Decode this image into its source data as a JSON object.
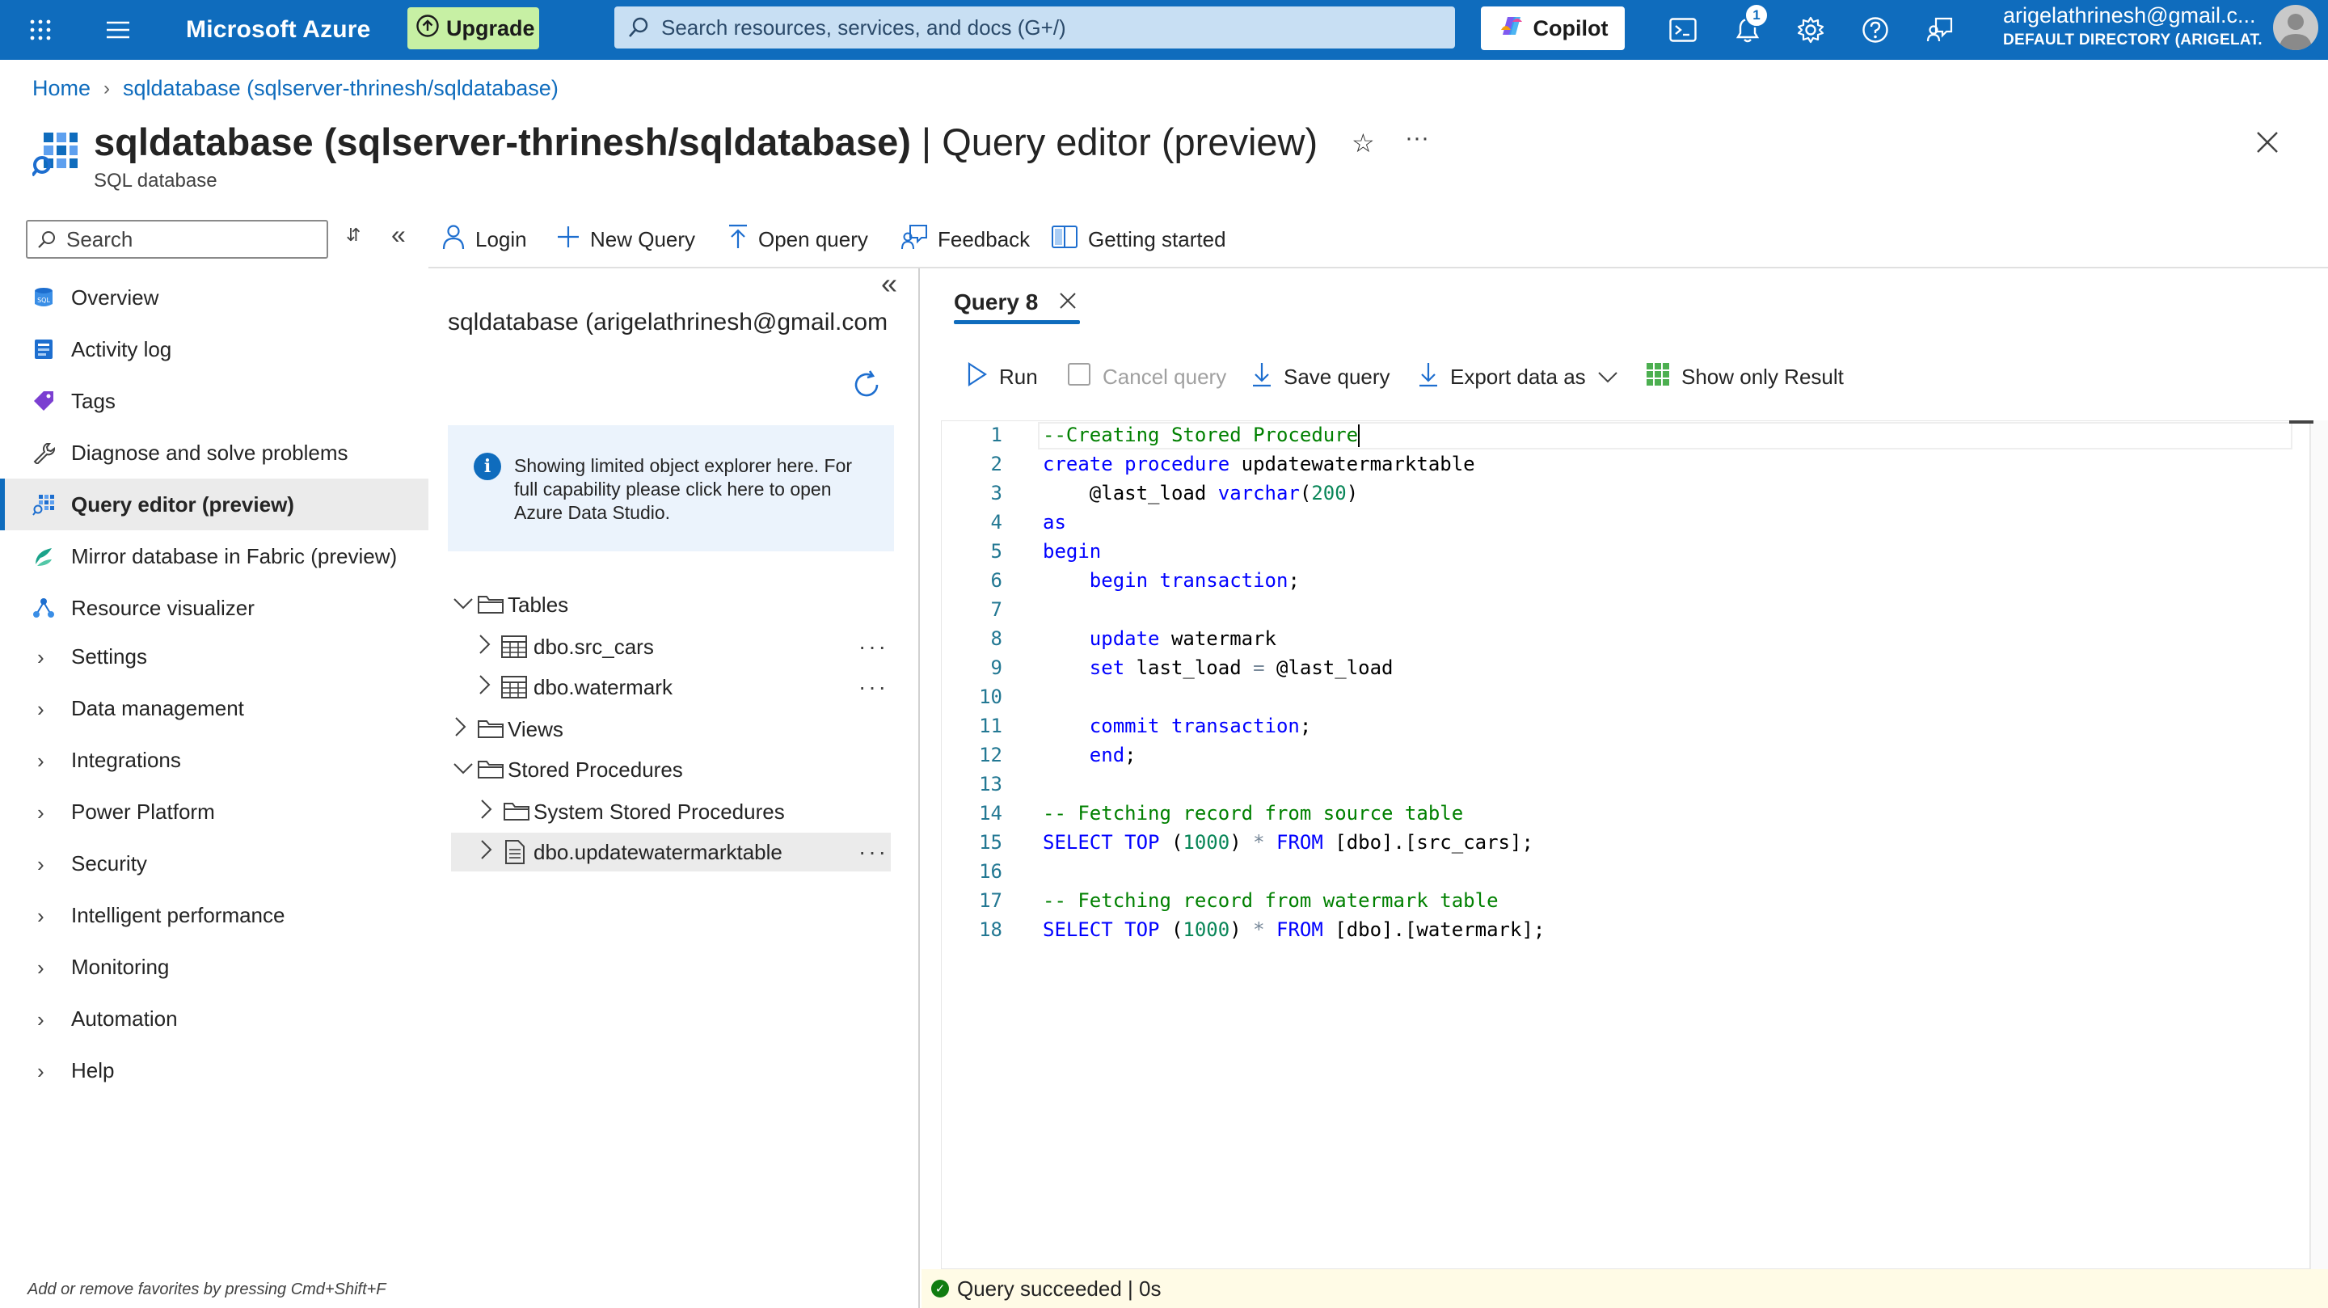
{
  "topbar": {
    "brand": "Microsoft Azure",
    "upgrade_label": "Upgrade",
    "search_placeholder": "Search resources, services, and docs (G+/)",
    "copilot_label": "Copilot",
    "notification_count": "1",
    "account_email": "arigelathrinesh@gmail.c...",
    "account_directory": "DEFAULT DIRECTORY (ARIGELAT...",
    "accent": "#0f6cbd"
  },
  "breadcrumb": {
    "home": "Home",
    "current": "sqldatabase (sqlserver-thrinesh/sqldatabase)"
  },
  "header": {
    "resource": "sqldatabase (sqlserver-thrinesh/sqldatabase)",
    "separator_title": " | Query editor (preview)",
    "subtitle": "SQL database",
    "more": "···"
  },
  "nav": {
    "search_placeholder": "Search",
    "items": [
      {
        "label": "Overview",
        "icon": "sql-icon"
      },
      {
        "label": "Activity log",
        "icon": "activity-log-icon"
      },
      {
        "label": "Tags",
        "icon": "tag-icon"
      },
      {
        "label": "Diagnose and solve problems",
        "icon": "wrench-icon"
      },
      {
        "label": "Query editor (preview)",
        "icon": "query-editor-icon"
      },
      {
        "label": "Mirror database in Fabric (preview)",
        "icon": "fabric-icon"
      },
      {
        "label": "Resource visualizer",
        "icon": "resource-visualizer-icon"
      }
    ],
    "groups": [
      "Settings",
      "Data management",
      "Integrations",
      "Power Platform",
      "Security",
      "Intelligent performance",
      "Monitoring",
      "Automation",
      "Help"
    ],
    "favorites_tip": "Add or remove favorites by pressing Cmd+Shift+F"
  },
  "toolbar": {
    "login": "Login",
    "new_query": "New Query",
    "open_query": "Open query",
    "feedback": "Feedback",
    "getting_started": "Getting started"
  },
  "explorer": {
    "title": "sqldatabase (arigelathrinesh@gmail.com",
    "info": "Showing limited object explorer here. For full capability please click here to open Azure Data Studio.",
    "tables": "Tables",
    "table_items": [
      "dbo.src_cars",
      "dbo.watermark"
    ],
    "views": "Views",
    "stored_procedures": "Stored Procedures",
    "system_stored_procedures": "System Stored Procedures",
    "procedure_item": "dbo.updatewatermarktable",
    "more": "···"
  },
  "editor": {
    "tab_label": "Query 8",
    "run": "Run",
    "cancel": "Cancel query",
    "save": "Save query",
    "export": "Export data as",
    "show_only_result": "Show only Result",
    "line_numbers": [
      "1",
      "2",
      "3",
      "4",
      "5",
      "6",
      "7",
      "8",
      "9",
      "10",
      "11",
      "12",
      "13",
      "14",
      "15",
      "16",
      "17",
      "18"
    ]
  },
  "status": {
    "text": "Query succeeded | 0s"
  }
}
